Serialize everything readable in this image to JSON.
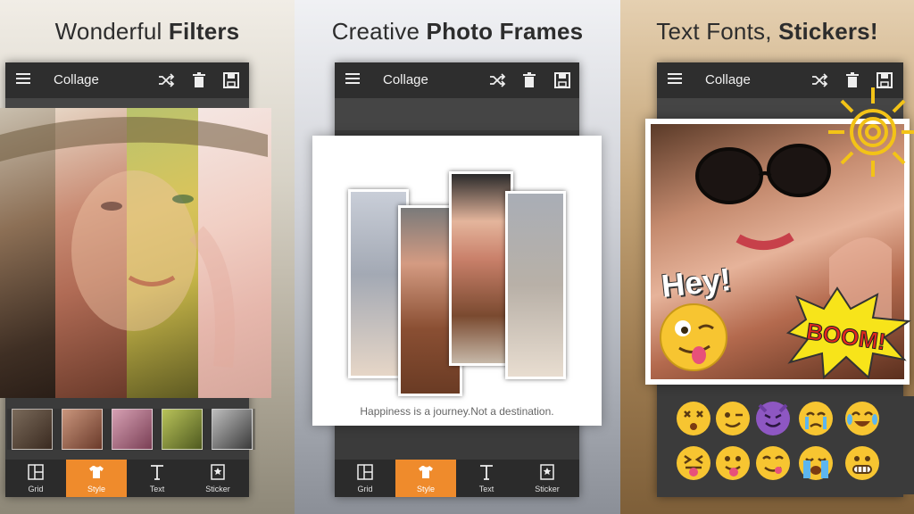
{
  "panels": [
    {
      "headline_regular": "Wonderful ",
      "headline_bold": "Filters",
      "appbar": {
        "title": "Collage"
      },
      "tabs": [
        {
          "label": "Grid",
          "icon": "grid-icon",
          "active": false
        },
        {
          "label": "Style",
          "icon": "shirt-icon",
          "active": true
        },
        {
          "label": "Text",
          "icon": "text-icon",
          "active": false
        },
        {
          "label": "Sticker",
          "icon": "sticker-icon",
          "active": false
        }
      ],
      "filter_thumbnails": [
        "filter-original",
        "filter-warm",
        "filter-rose",
        "filter-vivid",
        "filter-mono"
      ]
    },
    {
      "headline_regular": "Creative ",
      "headline_bold": "Photo Frames",
      "appbar": {
        "title": "Collage"
      },
      "frame_caption": "Happiness is a journey.Not a destination.",
      "tabs": [
        {
          "label": "Grid",
          "icon": "grid-icon",
          "active": false
        },
        {
          "label": "Style",
          "icon": "shirt-icon",
          "active": true
        },
        {
          "label": "Text",
          "icon": "text-icon",
          "active": false
        },
        {
          "label": "Sticker",
          "icon": "sticker-icon",
          "active": false
        }
      ]
    },
    {
      "headline_regular": "Text Fonts, ",
      "headline_bold": "Stickers!",
      "appbar": {
        "title": "Collage"
      },
      "stickers": {
        "hey": "Hey!",
        "boom": "BOOM!"
      },
      "emojis": [
        "dizzy-face",
        "winking-face",
        "smiling-devil",
        "crying-face",
        "tears-of-joy",
        "squinting-tongue",
        "tongue-out",
        "yum-face",
        "loudly-crying",
        "grimacing-face"
      ]
    }
  ],
  "colors": {
    "accent": "#ef8b2c",
    "appbar": "#2e2e2e",
    "emoji_yellow": "#f7c531"
  }
}
